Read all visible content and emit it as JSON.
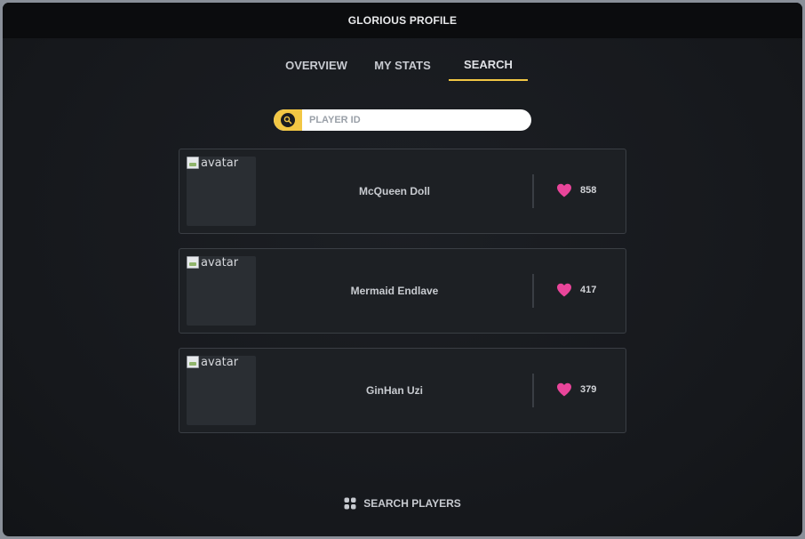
{
  "window": {
    "title": "GLORIOUS PROFILE"
  },
  "tabs": [
    {
      "label": "OVERVIEW",
      "active": false
    },
    {
      "label": "MY STATS",
      "active": false
    },
    {
      "label": "SEARCH",
      "active": true
    }
  ],
  "search": {
    "placeholder": "PLAYER ID",
    "value": "",
    "icon": "search-icon"
  },
  "players": [
    {
      "avatar_alt": "avatar",
      "name": "McQueen Doll",
      "likes": "858"
    },
    {
      "avatar_alt": "avatar",
      "name": "Mermaid Endlave",
      "likes": "417"
    },
    {
      "avatar_alt": "avatar",
      "name": "GinHan Uzi",
      "likes": "379"
    }
  ],
  "footer": {
    "label": "SEARCH PLAYERS",
    "icon": "grid-icon"
  },
  "colors": {
    "accent": "#f2c744",
    "heart": "#e9459a",
    "background": "#16181c"
  }
}
